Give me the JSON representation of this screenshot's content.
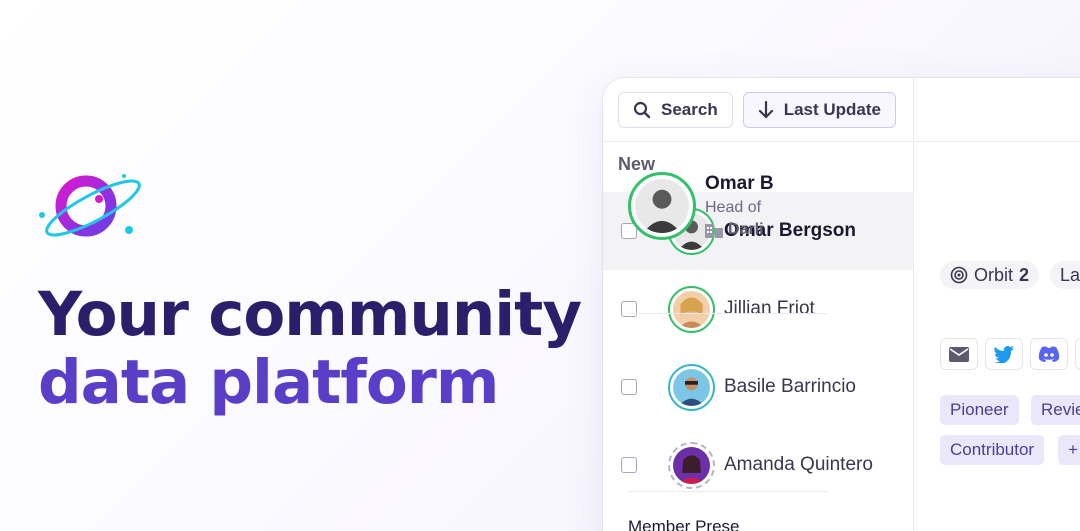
{
  "hero": {
    "headline_line1": "Your community",
    "headline_line2": "data platform"
  },
  "toolbar": {
    "search_label": "Search",
    "sort_label": "Last Update"
  },
  "list": {
    "section_label": "New",
    "members": [
      {
        "name": "Omar Bergson",
        "selected": true
      },
      {
        "name": "Jillian Friot",
        "selected": false
      },
      {
        "name": "Basile Barrincio",
        "selected": false
      },
      {
        "name": "Amanda Quintero",
        "selected": false
      }
    ]
  },
  "detail": {
    "name": "Omar B",
    "title": "Head of",
    "company": "Darli",
    "orbit_label": "Orbit",
    "orbit_value": "2",
    "last_pill": "La",
    "tags": [
      "Pioneer",
      "Revie",
      "Contributor",
      "+"
    ],
    "section_title": "Member Prese"
  },
  "icons": [
    "orbit-logo-icon",
    "search-icon",
    "arrow-down-icon",
    "building-icon",
    "orbit-level-icon",
    "mail-icon",
    "twitter-icon",
    "discord-icon"
  ],
  "colors": {
    "headline_dark": "#2b1f6b",
    "headline_purple": "#5a3ec8",
    "tag_bg": "#ebe7fa",
    "avatar_ring": "#34c06b"
  }
}
